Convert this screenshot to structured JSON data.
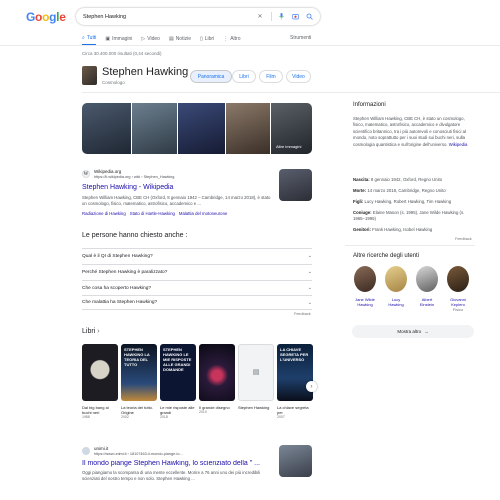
{
  "header": {
    "logo_letters": [
      "G",
      "o",
      "o",
      "g",
      "l",
      "e"
    ],
    "search_query": "Stephen Hawking",
    "icons": [
      "clear-icon",
      "mic-icon",
      "camera-icon",
      "search-icon"
    ]
  },
  "tabs": [
    {
      "label": "Tutti",
      "active": true
    },
    {
      "label": "Immagini"
    },
    {
      "label": "Video"
    },
    {
      "label": "Notizie"
    },
    {
      "label": "Libri"
    },
    {
      "label": "Altro"
    }
  ],
  "tools_label": "Strumenti",
  "stats": "Circa 30.400.000 risultati (0,44 secondi)",
  "entity": {
    "title": "Stephen Hawking",
    "subtitle": "Cosmologo",
    "pills": [
      "Panoramica",
      "Libri",
      "Film",
      "Video"
    ]
  },
  "images_more": "Altre immagini",
  "wiki": {
    "site": "Wikipedia.org",
    "url": "https://it.wikipedia.org › wiki › Stephen_Hawking",
    "title": "Stephen Hawking - Wikipedia",
    "snippet": "Stephen William Hawking, CBE CH (Oxford, 8 gennaio 1942 – Cambridge, 14 marzo 2018), è stato un cosmologo, fisico, matematico, astrofisico, accademico e ...",
    "links": [
      "Radiazione di Hawking",
      "Stato di Hartle-Hawking",
      "Malattia del motoneurone"
    ]
  },
  "paa": {
    "heading": "Le persone hanno chiesto anche :",
    "questions": [
      "Qual è il QI di Stephen Hawking?",
      "Perché Stephen Hawking è paralizzato?",
      "Che cosa ha scoperto Hawking?",
      "Che malattia ha Stephen Hawking?"
    ],
    "feedback": "Feedback"
  },
  "books": {
    "heading": "Libri",
    "items": [
      {
        "cover": "",
        "caption": "Dal big bang ai buchi neri",
        "year": "1988"
      },
      {
        "cover": "STEPHEN HAWKING LA TEORIA DEL TUTTO",
        "caption": "La teoria del tutto. Origine",
        "year": "2002"
      },
      {
        "cover": "STEPHEN HAWKING LE MIE RISPOSTE ALLE GRANDI DOMANDE",
        "caption": "Le mie risposte alle grandi",
        "year": "2018"
      },
      {
        "cover": "",
        "caption": "Il grande disegno",
        "year": "2010"
      },
      {
        "cover": "",
        "caption": "Stephen Hawking",
        "year": ""
      },
      {
        "cover": "LA CHIAVE SEGRETA PER L'UNIVERSO",
        "caption": "La chiave segreta per",
        "year": "2007"
      }
    ]
  },
  "unimi": {
    "site": "unimi.it",
    "url": "https://www.unimi.it › 18107463-il-mondo-piange-lo...",
    "title": "Il mondo piange Stephen Hawking, lo scienziato della \" ...",
    "snippet": "Oggi piangiamo la scomparsa di una mente eccellente. Morire a 76 anni uno dei più incredibili scienziati del nostro tempo e non solo. Stephen Hawking ..."
  },
  "panel": {
    "heading": "Informazioni",
    "description": "Stephen William Hawking, CBE CH, è stato un cosmologo, fisico, matematico, astrofisico, accademico e divulgatore scientifico britannico, tra i più autorevoli e conosciuti fisici al mondo, noto soprattutto per i suoi studi sui buchi neri, sulla cosmologia quantistica e sull'origine dell'universo.",
    "desc_link": "Wikipedia",
    "facts": [
      {
        "label": "Nascita:",
        "value": "8 gennaio 1942, Oxford, Regno Unito"
      },
      {
        "label": "Morte:",
        "value": "14 marzo 2018, Cambridge, Regno Unito"
      },
      {
        "label": "Figli:",
        "value": "Lucy Hawking, Robert Hawking, Tim Hawking"
      },
      {
        "label": "Coniuge:",
        "value": "Elaine Mason (s. 1995), Jane Wilde Hawking (s. 1965–1995)"
      },
      {
        "label": "Genitori:",
        "value": "Frank Hawking, Isobel Hawking"
      }
    ],
    "feedback": "Feedback",
    "also_heading": "Altre ricerche degli utenti",
    "people": [
      {
        "name": "Jane Wilde Hawking",
        "sub": ""
      },
      {
        "name": "Lucy Hawking",
        "sub": ""
      },
      {
        "name": "Albert Einstein",
        "sub": ""
      },
      {
        "name": "Giovanni Keplero",
        "sub": "Fisico"
      }
    ],
    "show_more": "Mostra altro"
  }
}
